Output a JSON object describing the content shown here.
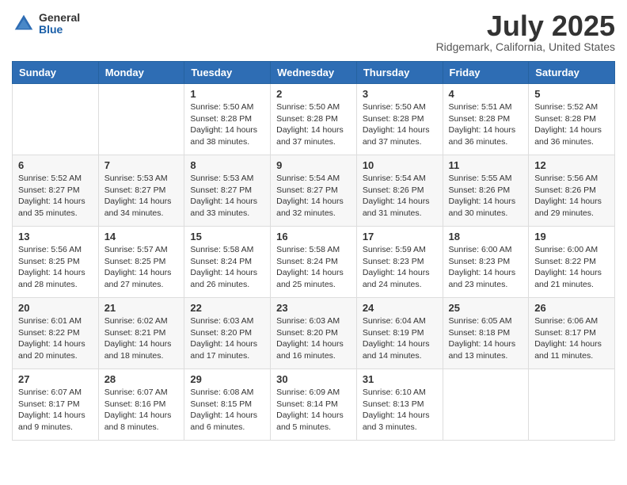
{
  "logo": {
    "general": "General",
    "blue": "Blue"
  },
  "title": "July 2025",
  "location": "Ridgemark, California, United States",
  "weekdays": [
    "Sunday",
    "Monday",
    "Tuesday",
    "Wednesday",
    "Thursday",
    "Friday",
    "Saturday"
  ],
  "weeks": [
    [
      {
        "day": "",
        "content": ""
      },
      {
        "day": "",
        "content": ""
      },
      {
        "day": "1",
        "content": "Sunrise: 5:50 AM\nSunset: 8:28 PM\nDaylight: 14 hours\nand 38 minutes."
      },
      {
        "day": "2",
        "content": "Sunrise: 5:50 AM\nSunset: 8:28 PM\nDaylight: 14 hours\nand 37 minutes."
      },
      {
        "day": "3",
        "content": "Sunrise: 5:50 AM\nSunset: 8:28 PM\nDaylight: 14 hours\nand 37 minutes."
      },
      {
        "day": "4",
        "content": "Sunrise: 5:51 AM\nSunset: 8:28 PM\nDaylight: 14 hours\nand 36 minutes."
      },
      {
        "day": "5",
        "content": "Sunrise: 5:52 AM\nSunset: 8:28 PM\nDaylight: 14 hours\nand 36 minutes."
      }
    ],
    [
      {
        "day": "6",
        "content": "Sunrise: 5:52 AM\nSunset: 8:27 PM\nDaylight: 14 hours\nand 35 minutes."
      },
      {
        "day": "7",
        "content": "Sunrise: 5:53 AM\nSunset: 8:27 PM\nDaylight: 14 hours\nand 34 minutes."
      },
      {
        "day": "8",
        "content": "Sunrise: 5:53 AM\nSunset: 8:27 PM\nDaylight: 14 hours\nand 33 minutes."
      },
      {
        "day": "9",
        "content": "Sunrise: 5:54 AM\nSunset: 8:27 PM\nDaylight: 14 hours\nand 32 minutes."
      },
      {
        "day": "10",
        "content": "Sunrise: 5:54 AM\nSunset: 8:26 PM\nDaylight: 14 hours\nand 31 minutes."
      },
      {
        "day": "11",
        "content": "Sunrise: 5:55 AM\nSunset: 8:26 PM\nDaylight: 14 hours\nand 30 minutes."
      },
      {
        "day": "12",
        "content": "Sunrise: 5:56 AM\nSunset: 8:26 PM\nDaylight: 14 hours\nand 29 minutes."
      }
    ],
    [
      {
        "day": "13",
        "content": "Sunrise: 5:56 AM\nSunset: 8:25 PM\nDaylight: 14 hours\nand 28 minutes."
      },
      {
        "day": "14",
        "content": "Sunrise: 5:57 AM\nSunset: 8:25 PM\nDaylight: 14 hours\nand 27 minutes."
      },
      {
        "day": "15",
        "content": "Sunrise: 5:58 AM\nSunset: 8:24 PM\nDaylight: 14 hours\nand 26 minutes."
      },
      {
        "day": "16",
        "content": "Sunrise: 5:58 AM\nSunset: 8:24 PM\nDaylight: 14 hours\nand 25 minutes."
      },
      {
        "day": "17",
        "content": "Sunrise: 5:59 AM\nSunset: 8:23 PM\nDaylight: 14 hours\nand 24 minutes."
      },
      {
        "day": "18",
        "content": "Sunrise: 6:00 AM\nSunset: 8:23 PM\nDaylight: 14 hours\nand 23 minutes."
      },
      {
        "day": "19",
        "content": "Sunrise: 6:00 AM\nSunset: 8:22 PM\nDaylight: 14 hours\nand 21 minutes."
      }
    ],
    [
      {
        "day": "20",
        "content": "Sunrise: 6:01 AM\nSunset: 8:22 PM\nDaylight: 14 hours\nand 20 minutes."
      },
      {
        "day": "21",
        "content": "Sunrise: 6:02 AM\nSunset: 8:21 PM\nDaylight: 14 hours\nand 18 minutes."
      },
      {
        "day": "22",
        "content": "Sunrise: 6:03 AM\nSunset: 8:20 PM\nDaylight: 14 hours\nand 17 minutes."
      },
      {
        "day": "23",
        "content": "Sunrise: 6:03 AM\nSunset: 8:20 PM\nDaylight: 14 hours\nand 16 minutes."
      },
      {
        "day": "24",
        "content": "Sunrise: 6:04 AM\nSunset: 8:19 PM\nDaylight: 14 hours\nand 14 minutes."
      },
      {
        "day": "25",
        "content": "Sunrise: 6:05 AM\nSunset: 8:18 PM\nDaylight: 14 hours\nand 13 minutes."
      },
      {
        "day": "26",
        "content": "Sunrise: 6:06 AM\nSunset: 8:17 PM\nDaylight: 14 hours\nand 11 minutes."
      }
    ],
    [
      {
        "day": "27",
        "content": "Sunrise: 6:07 AM\nSunset: 8:17 PM\nDaylight: 14 hours\nand 9 minutes."
      },
      {
        "day": "28",
        "content": "Sunrise: 6:07 AM\nSunset: 8:16 PM\nDaylight: 14 hours\nand 8 minutes."
      },
      {
        "day": "29",
        "content": "Sunrise: 6:08 AM\nSunset: 8:15 PM\nDaylight: 14 hours\nand 6 minutes."
      },
      {
        "day": "30",
        "content": "Sunrise: 6:09 AM\nSunset: 8:14 PM\nDaylight: 14 hours\nand 5 minutes."
      },
      {
        "day": "31",
        "content": "Sunrise: 6:10 AM\nSunset: 8:13 PM\nDaylight: 14 hours\nand 3 minutes."
      },
      {
        "day": "",
        "content": ""
      },
      {
        "day": "",
        "content": ""
      }
    ]
  ]
}
